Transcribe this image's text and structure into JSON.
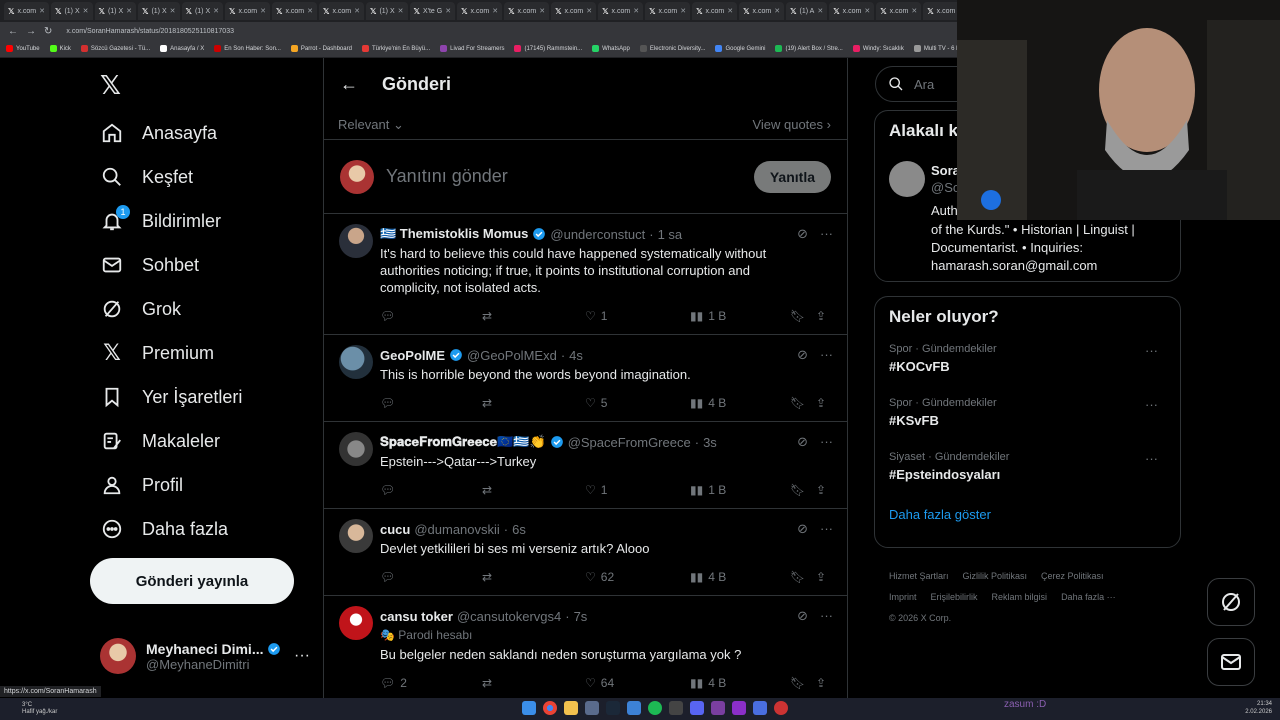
{
  "browser": {
    "tabs": [
      "x.com",
      "(1) X",
      "(1) X",
      "(1) X",
      "(1) X",
      "x.com",
      "x.com",
      "x.com",
      "(1) X",
      "X'te G",
      "x.com",
      "x.com",
      "x.com",
      "x.com",
      "x.com",
      "x.com",
      "x.com",
      "(1) A",
      "x.com",
      "x.com",
      "x.com",
      "x.com"
    ],
    "url": "x.com/SoranHamarash/status/2018180525110817033",
    "bookmarks": [
      "YouTube",
      "Kick",
      "Sözcü Gazetesi - Tü...",
      "Anasayfa / X",
      "En Son Haber: Son...",
      "Parrot - Dashboard",
      "Türkiye'nin En Büyü...",
      "Livad For Streamers",
      "(17145) Rammstein...",
      "WhatsApp",
      "Electronic Diversity...",
      "Google Gemini",
      "(19) Alert Box / Stre...",
      "Windy: Sıcaklık",
      "Multi TV - 6 haber"
    ],
    "status_url": "https://x.com/SoranHamarash"
  },
  "sidebar": {
    "items": [
      {
        "label": "Anasayfa"
      },
      {
        "label": "Keşfet"
      },
      {
        "label": "Bildirimler",
        "badge": "1"
      },
      {
        "label": "Sohbet"
      },
      {
        "label": "Grok"
      },
      {
        "label": "Premium"
      },
      {
        "label": "Yer İşaretleri"
      },
      {
        "label": "Makaleler"
      },
      {
        "label": "Profil"
      },
      {
        "label": "Daha fazla"
      }
    ],
    "post_button": "Gönderi yayınla",
    "account": {
      "name": "Meyhaneci Dimi...",
      "handle": "@MeyhaneDimitri"
    }
  },
  "main": {
    "title": "Gönderi",
    "sort": "Relevant",
    "view_quotes": "View quotes",
    "reply_placeholder": "Yanıtını gönder",
    "reply_button": "Yanıtla",
    "tweets": [
      {
        "name": "🇬🇷 Themistoklis Momus",
        "handle": "@underconstuct",
        "time": "1 sa",
        "text": "It's hard to believe this could have happened systematically without authorities noticing; if true, it points to institutional corruption and complicity, not isolated acts.",
        "replies": "",
        "retweets": "",
        "likes": "1",
        "views": "1 B"
      },
      {
        "name": "GeoPolME",
        "handle": "@GeoPolMExd",
        "time": "4s",
        "text": "This is horrible beyond the words beyond imagination.",
        "replies": "",
        "retweets": "",
        "likes": "5",
        "views": "4 B"
      },
      {
        "name": "𝐒𝐩𝐚𝐜𝐞𝐅𝐫𝐨𝐦𝐆𝐫𝐞𝐞𝐜𝐞🇪🇺🇬🇷👏",
        "handle": "@SpaceFromGreece",
        "time": "3s",
        "text": "Epstein--->Qatar--->Turkey",
        "replies": "",
        "retweets": "",
        "likes": "1",
        "views": "1 B"
      },
      {
        "name": "cucu",
        "handle": "@dumanovskii",
        "time": "6s",
        "text": "Devlet yetkilileri bi ses mi verseniz artık? Alooo",
        "replies": "",
        "retweets": "",
        "likes": "62",
        "views": "4 B"
      },
      {
        "name": "cansu toker",
        "handle": "@cansutokervgs4",
        "time": "7s",
        "parody": "Parodi hesabı",
        "text": "Bu belgeler neden saklandı neden soruşturma yargılama yok ?",
        "replies": "2",
        "retweets": "",
        "likes": "64",
        "views": "4 B"
      }
    ]
  },
  "right": {
    "search_placeholder": "Ara",
    "related_title": "Alakalı k",
    "related_name": "Sora",
    "related_handle": "@So",
    "related_bio_1": "Auth",
    "related_bio_2": "of the Kurds.\" • Historian | Linguist | Documentarist. • Inquiries: hamarash.soran@gmail.com",
    "trends_title": "Neler oluyor?",
    "trends": [
      {
        "category": "Spor · Gündemdekiler",
        "name": "#KOCvFB"
      },
      {
        "category": "Spor · Gündemdekiler",
        "name": "#KSvFB"
      },
      {
        "category": "Siyaset · Gündemdekiler",
        "name": "#Epsteindosyaları"
      }
    ],
    "show_more": "Daha fazla göster",
    "footer": [
      "Hizmet Şartları",
      "Gizlilik Politikası",
      "Çerez Politikası",
      "Imprint",
      "Erişilebilirlik",
      "Reklam bilgisi",
      "Daha fazla ···",
      "© 2026 X Corp."
    ]
  },
  "taskbar": {
    "weather_temp": "3°C",
    "weather_desc": "Hafif yağ./kar",
    "overlay_text": "zasum :D",
    "time": "21:34",
    "date": "2.02.2026"
  },
  "colors": {
    "accent": "#1d9bf0",
    "bg": "#000000",
    "border": "#2f3336",
    "muted": "#71767b"
  }
}
